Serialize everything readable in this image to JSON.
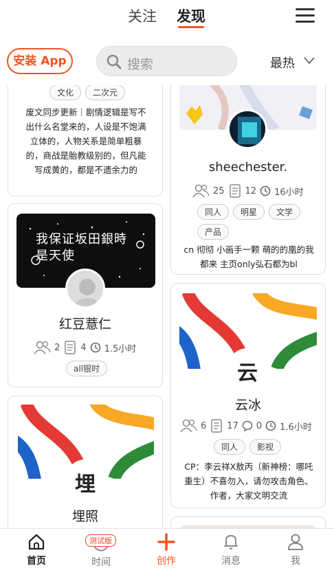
{
  "nav": {
    "tabs": [
      "关注",
      "发现"
    ],
    "active_tab": "发现"
  },
  "toolbar": {
    "install_label": "安装 App",
    "search_placeholder": "搜索",
    "sort_label": "最热"
  },
  "cards": {
    "c1": {
      "tags": [
        "文化",
        "二次元"
      ],
      "desc": "废文同步更新｜剧情逻辑是写不出什么名堂来的，人设是不饱满立体的，人物关系是简单粗暴的，商战是胎教级别的，但凡能写成黄的，都是不遗余力的"
    },
    "c2": {
      "banner_text": "我保证坂田銀時是天使",
      "title": "红豆薏仁",
      "members": "2",
      "posts": "4",
      "time": "1.5小时",
      "tags": [
        "all银时"
      ]
    },
    "c3": {
      "avatar_char": "埋",
      "title": "埋照"
    },
    "c4": {
      "title": "sheechester.",
      "members": "25",
      "posts": "12",
      "time": "16小时",
      "tags": [
        "同人",
        "明星",
        "文学",
        "产品"
      ],
      "desc": "cn 彻彻 小画手一颗 萌的的凰的我都来 主页only弘石都为bl"
    },
    "c5": {
      "avatar_char": "云",
      "title": "云冰",
      "members": "6",
      "posts": "17",
      "comments": "0",
      "time": "1.6小时",
      "tags": [
        "同人",
        "影视"
      ],
      "desc": "CP：李云祥X敖丙（新神榜：哪吒重生）不喜勿入，请勿攻击角色、作者，大家文明交流"
    }
  },
  "bottom_nav": {
    "home": "首页",
    "time": "时间",
    "time_badge": "测试版",
    "create": "创作",
    "messages": "消息",
    "me": "我"
  },
  "colors": {
    "accent": "#f0541f",
    "stripe_red": "#e53935",
    "stripe_yellow": "#f9a825",
    "stripe_green": "#2e8b3a",
    "stripe_blue": "#1e64c8"
  }
}
